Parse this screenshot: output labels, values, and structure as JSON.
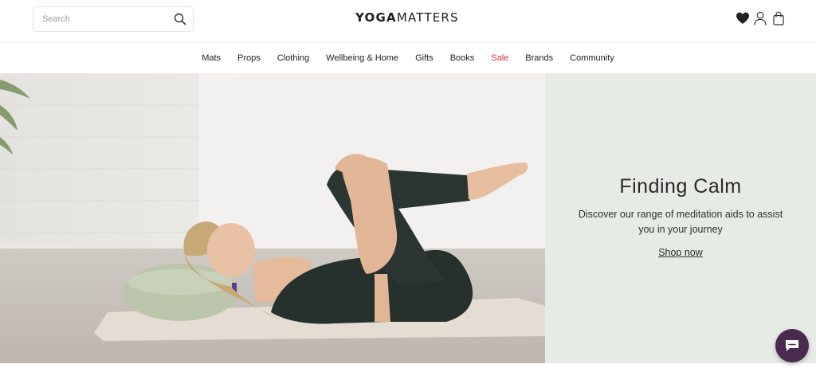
{
  "header": {
    "search": {
      "placeholder": "Search",
      "icon": "search-icon"
    },
    "logo": {
      "bold": "YOGA",
      "light": "MATTERS"
    },
    "icons": [
      "heart-icon",
      "user-icon",
      "shopping-bag-icon"
    ]
  },
  "nav": {
    "items": [
      {
        "label": "Mats"
      },
      {
        "label": "Props"
      },
      {
        "label": "Clothing"
      },
      {
        "label": "Wellbeing & Home"
      },
      {
        "label": "Gifts"
      },
      {
        "label": "Books"
      },
      {
        "label": "Sale"
      },
      {
        "label": "Brands"
      },
      {
        "label": "Community"
      }
    ]
  },
  "hero": {
    "title": "Finding Calm",
    "text": "Discover our range of meditation aids to assist you in your journey",
    "cta": "Shop now"
  },
  "colors": {
    "sale": "#d8323c",
    "panel": "#e7ebe5",
    "chat": "#4a2b4f"
  }
}
